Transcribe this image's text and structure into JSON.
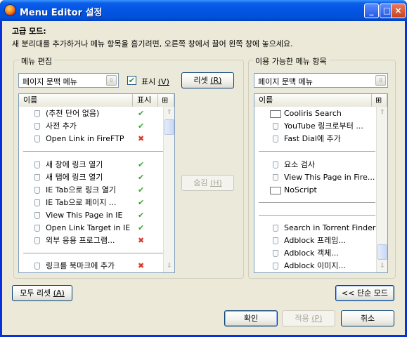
{
  "window": {
    "title": "Menu Editor 설정",
    "controls": [
      "_",
      "□",
      "×"
    ]
  },
  "advanced": {
    "heading": "고급 모드:",
    "description": "새 분리대를 추가하거나 메뉴 항목을 흠기려면, 오른쪽 창에서 끌어 왼쪽 창에 놓으세요."
  },
  "left_panel": {
    "title": "메뉴 편집",
    "menu_select": "페이지 문맥 메뉴",
    "show_checkbox_label": "표시",
    "show_checkbox_key": "(V)",
    "show_checked": true,
    "check_mark": "✔",
    "reset_button": "리셋",
    "reset_key": "(R)",
    "columns": {
      "name": "이름",
      "show": "표시",
      "picker": "⊞"
    },
    "items": [
      {
        "label": "(추천 단어 없음)",
        "visible": "✔"
      },
      {
        "label": "사전 추가",
        "visible": "✔"
      },
      {
        "label": "Open Link in FireFTP",
        "visible": "✖"
      },
      {
        "label": "새 창에 링크 열기",
        "visible": "✔"
      },
      {
        "label": "새 탭에 링크 열기",
        "visible": "✔"
      },
      {
        "label": "IE Tab으로 링크 열기",
        "visible": "✔"
      },
      {
        "label": "IE Tab으로 페이지 ...",
        "visible": "✔"
      },
      {
        "label": "View This Page in IE",
        "visible": "✔"
      },
      {
        "label": "Open Link Target in IE",
        "visible": "✔"
      },
      {
        "label": "외부 응용 프로그램...",
        "visible": "✖"
      },
      {
        "label": "링크를 북마크에 추가",
        "visible": "✖"
      }
    ]
  },
  "middle": {
    "hide_button": "숨김",
    "hide_key": "(H)"
  },
  "right_panel": {
    "title": "이용 가능한 메뉴 항목",
    "menu_select": "페이지 문맥 메뉴",
    "columns": {
      "name": "이름",
      "picker": "⊞"
    },
    "items": [
      {
        "label": "Cooliris Search"
      },
      {
        "label": "YouTube 링크로부터 ..."
      },
      {
        "label": "Fast Dial에 추가"
      },
      {
        "label": "요소 검사"
      },
      {
        "label": "View This Page in Fire..."
      },
      {
        "label": "NoScript"
      },
      {
        "label": "Search in Torrent Finder"
      },
      {
        "label": "Adblock 프레임..."
      },
      {
        "label": "Adblock 객체..."
      },
      {
        "label": "Adblock 이미지..."
      }
    ]
  },
  "scroll_arrows": {
    "up": "⇧",
    "down": "⇩",
    "dropdown": "⇩"
  },
  "footer": {
    "reset_all": "모두 리셋",
    "reset_all_key": "(A)",
    "simple_mode": "<< 단순 모드",
    "ok": "확인",
    "apply": "적용",
    "apply_key": "(P)",
    "cancel": "취소"
  },
  "colors": {
    "titlebar": "#0354e3",
    "dialog_bg": "#ece9d8",
    "check": "#3aa63a",
    "cross": "#d43a2a"
  }
}
